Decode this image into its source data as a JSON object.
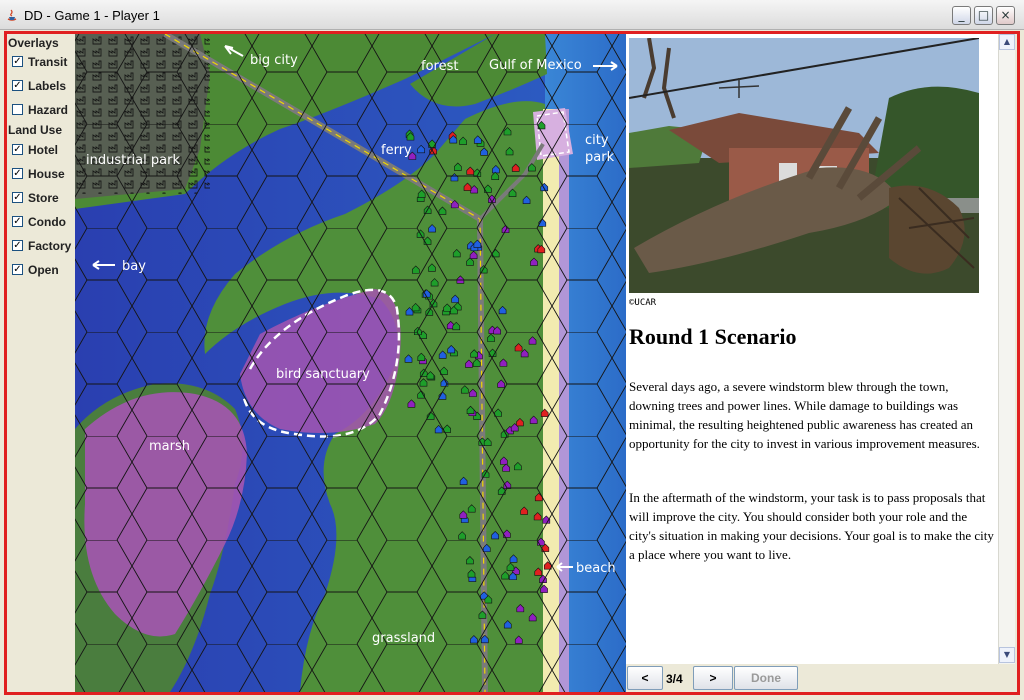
{
  "window": {
    "title": "DD - Game 1 - Player 1",
    "controls": {
      "minimize": "_",
      "maximize": "□",
      "close": "×"
    },
    "frame_color": "#e02020"
  },
  "overlays_panel": {
    "overlays_title": "Overlays",
    "overlays": [
      {
        "label": "Transit",
        "checked": true
      },
      {
        "label": "Labels",
        "checked": true
      },
      {
        "label": "Hazard",
        "checked": false
      }
    ],
    "land_use_title": "Land Use",
    "land_use": [
      {
        "label": "Hotel",
        "checked": true
      },
      {
        "label": "House",
        "checked": true
      },
      {
        "label": "Store",
        "checked": true
      },
      {
        "label": "Condo",
        "checked": true
      },
      {
        "label": "Factory",
        "checked": true
      },
      {
        "label": "Open",
        "checked": true
      }
    ]
  },
  "map": {
    "labels": {
      "big_city": "big city",
      "forest": "forest",
      "gulf": "Gulf of Mexico",
      "industrial_park": "industrial park",
      "ferry": "ferry",
      "city_park_1": "city",
      "city_park_2": "park",
      "bay": "bay",
      "bird_sanctuary": "bird sanctuary",
      "marsh": "marsh",
      "beach": "beach",
      "grassland": "grassland"
    },
    "colors": {
      "water": "#2a47b5",
      "land": "#4f8f3a",
      "marsh": "#a455b0",
      "sand": "#f0e7a8",
      "road": "#777777",
      "house": "#1e9e2a",
      "hotel": "#e02020",
      "store": "#2060e0",
      "condo": "#9020c0"
    }
  },
  "scenario": {
    "photo_credit": "©UCAR",
    "title": "Round 1 Scenario",
    "paragraph_1": "Several days ago, a severe windstorm blew through the town, downing trees and power lines. While damage to buildings was minimal, the resulting heightened public awareness has created an opportunity for the city to invest in various improvement measures.",
    "paragraph_2": "In the aftermath of the windstorm, your task is to pass proposals that will improve the city. You should consider both your role and the city's situation in making your decisions. Your goal is to make the city a place where you want to live."
  },
  "navigation": {
    "prev_label": "<",
    "page_indicator": "3/4",
    "next_label": ">",
    "done_label": "Done"
  },
  "scrollbar": {
    "up": "▲",
    "down": "▼"
  }
}
